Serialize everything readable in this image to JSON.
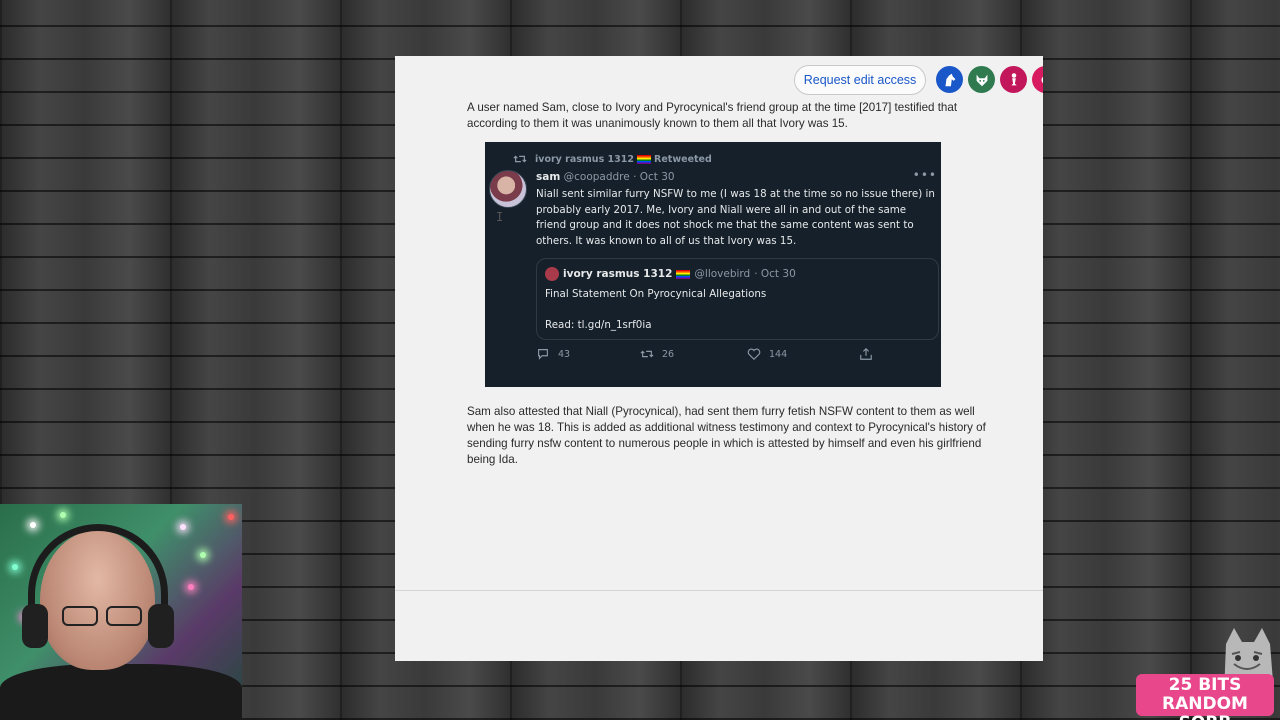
{
  "document": {
    "request_edit_label": "Request edit access",
    "collaborators": [
      {
        "icon": "horse-icon",
        "color": "#1a57c8"
      },
      {
        "icon": "wolf-icon",
        "color": "#2f7a4f"
      },
      {
        "icon": "chess-piece-icon",
        "color": "#c2185b"
      },
      {
        "icon": "avatar-partial-icon",
        "color": "#d81b60"
      }
    ],
    "paragraph_1": "A user named Sam, close to Ivory and Pyrocynical's friend group at the time [2017] testified that according to them it was unanimously known to them all that Ivory was 15.",
    "paragraph_2": "Sam also attested that Niall (Pyrocynical), had sent them furry fetish NSFW content to them as well when he was 18. This is added as additional witness testimony and context to Pyrocynical's history of sending furry nsfw content to numerous people in which is attested by himself and even his girlfriend being Ida."
  },
  "tweet": {
    "retweeted_by": "ivory rasmus 1312",
    "retweeted_label": "Retweeted",
    "author_name": "sam",
    "author_handle": "@coopaddre",
    "date": "· Oct 30",
    "body": "Niall sent similar furry NSFW to me (I was 18 at the time so no issue there) in probably early 2017. Me, Ivory and Niall were all in and out of the same friend group and it does not shock me that the same content was sent to others. It was known to all of us that Ivory was 15.",
    "quote": {
      "author_name": "ivory rasmus 1312",
      "author_handle": "@llovebird",
      "date": "· Oct 30",
      "line_1": "Final Statement On Pyrocynical Allegations",
      "line_2": "Read: tl.gd/n_1srf0ia"
    },
    "replies": "43",
    "retweets": "26",
    "likes": "144",
    "more": "•••"
  },
  "stream": {
    "bits_line_1": "25 BITS",
    "bits_line_2": "RANDOM SORB"
  }
}
